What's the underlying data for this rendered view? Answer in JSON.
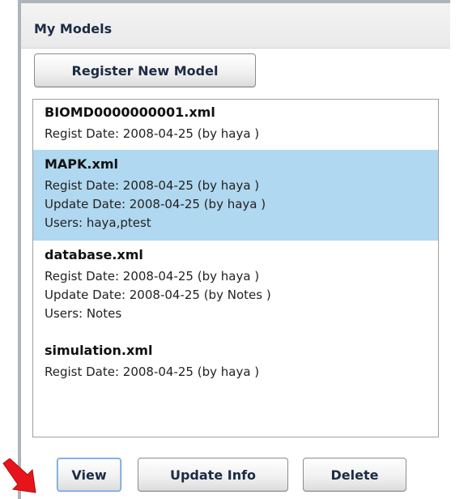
{
  "panel": {
    "title": "My Models",
    "register_button_label": "Register New Model"
  },
  "models": [
    {
      "name": "BIOMD0000000001.xml",
      "regist": "Regist Date: 2008-04-25 (by haya )",
      "selected": false
    },
    {
      "name": "MAPK.xml",
      "regist": "Regist Date: 2008-04-25 (by haya )",
      "update": "Update Date: 2008-04-25 (by haya )",
      "users": "Users: haya,ptest",
      "selected": true
    },
    {
      "name": "database.xml",
      "regist": "Regist Date: 2008-04-25 (by haya )",
      "update": "Update Date: 2008-04-25 (by Notes )",
      "users": "Users: Notes",
      "selected": false
    },
    {
      "name": "simulation.xml",
      "regist": "Regist Date: 2008-04-25 (by haya )",
      "selected": false
    }
  ],
  "actions": {
    "view_label": "View",
    "update_info_label": "Update Info",
    "delete_label": "Delete"
  },
  "annotation": {
    "arrow_icon": "red-pointer-arrow-icon",
    "arrow_color": "#e8141c"
  },
  "colors": {
    "selection": "#b0d8f0",
    "header_text": "#1c2c44"
  }
}
